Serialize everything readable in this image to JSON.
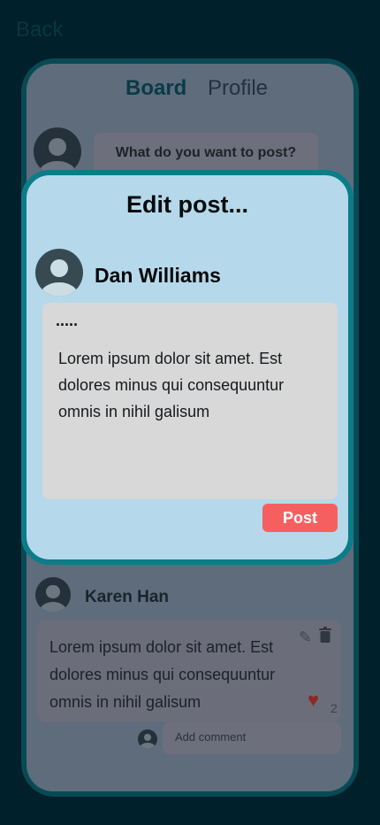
{
  "header": {
    "back_label": "Back"
  },
  "board": {
    "tabs": [
      {
        "label": "Board"
      },
      {
        "label": "Profile"
      }
    ],
    "compose_placeholder": "What do you want to post?",
    "post": {
      "author": "Karen Han",
      "body": "Lorem ipsum dolor sit amet. Est dolores minus qui consequuntur omnis in nihil galisum",
      "likes": "2"
    },
    "comment_placeholder": "Add comment"
  },
  "modal": {
    "title": "Edit post...",
    "user_name": "Dan Williams",
    "post_title": ".....",
    "post_body": "Lorem ipsum dolor sit amet. Est dolores minus qui consequuntur omnis in nihil galisum",
    "post_button": "Post"
  },
  "colors": {
    "background": "#00202c",
    "modal_border": "#0a7d89",
    "modal_bg": "#b5d9ea",
    "accent": "#f65f60"
  }
}
